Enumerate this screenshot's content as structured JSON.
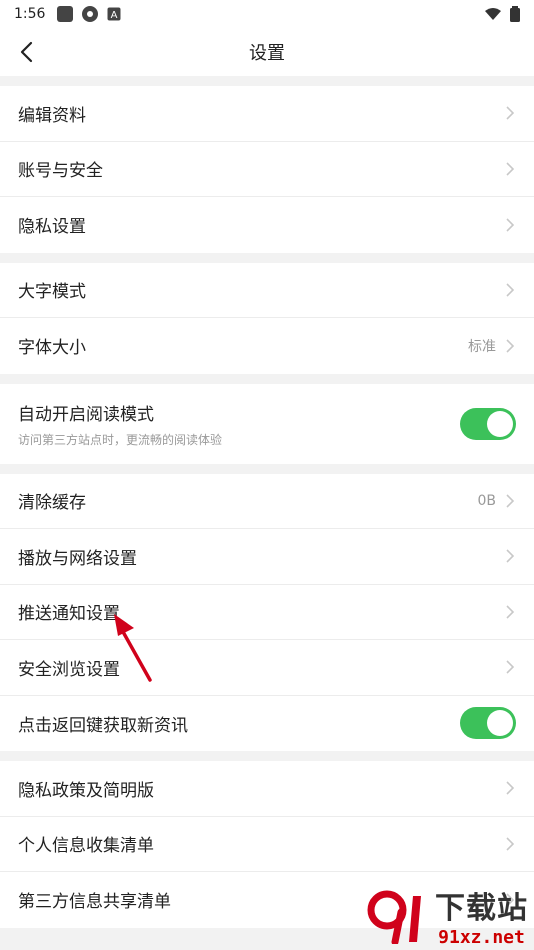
{
  "status": {
    "time": "1:56"
  },
  "header": {
    "title": "设置"
  },
  "groups": [
    {
      "items": [
        {
          "label": "编辑资料"
        },
        {
          "label": "账号与安全"
        },
        {
          "label": "隐私设置"
        }
      ]
    },
    {
      "items": [
        {
          "label": "大字模式"
        },
        {
          "label": "字体大小",
          "value": "标准"
        }
      ]
    },
    {
      "items": [
        {
          "label": "自动开启阅读模式",
          "subtitle": "访问第三方站点时，更流畅的阅读体验",
          "toggle": true
        }
      ]
    },
    {
      "items": [
        {
          "label": "清除缓存",
          "value": "0B"
        },
        {
          "label": "播放与网络设置"
        },
        {
          "label": "推送通知设置"
        },
        {
          "label": "安全浏览设置"
        },
        {
          "label": "点击返回键获取新资讯",
          "toggle": true
        }
      ]
    },
    {
      "items": [
        {
          "label": "隐私政策及简明版"
        },
        {
          "label": "个人信息收集清单"
        },
        {
          "label": "第三方信息共享清单"
        }
      ]
    }
  ],
  "watermark": {
    "brand": "下载站",
    "url": "91xz.net"
  },
  "colors": {
    "toggle_on": "#3cc15a",
    "arrow": "#d0021b",
    "chevron": "#c8c8c8"
  }
}
